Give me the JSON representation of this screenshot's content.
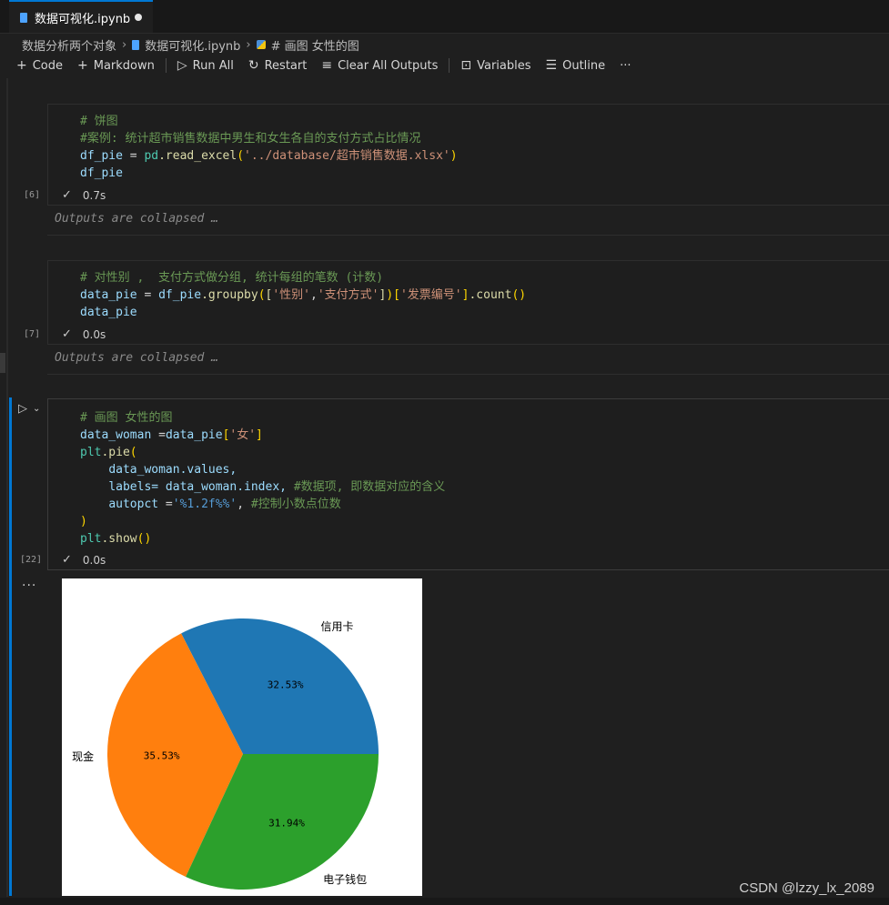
{
  "tab": {
    "title": "数据可视化.ipynb"
  },
  "breadcrumb": {
    "folder": "数据分析两个对象",
    "file": "数据可视化.ipynb",
    "symbol": "# 画图 女性的图"
  },
  "toolbar": {
    "code": "Code",
    "markdown": "Markdown",
    "run_all": "Run All",
    "restart": "Restart",
    "clear": "Clear All Outputs",
    "variables": "Variables",
    "outline": "Outline",
    "more": "···"
  },
  "cells": [
    {
      "count": "[6]",
      "time": "0.7s",
      "line1": "# 饼图",
      "line2": "#案例: 统计超市销售数据中男生和女生各自的支付方式占比情况",
      "line3_var": "df_pie",
      "line3_eq": " = ",
      "line3_mod": "pd",
      "line3_fn": ".read_excel",
      "line3_str": "'../database/超市销售数据.xlsx'",
      "line4": "df_pie",
      "collapsed": "Outputs are collapsed …"
    },
    {
      "count": "[7]",
      "time": "0.0s",
      "line1": "# 对性别 ,  支付方式做分组, 统计每组的笔数 (计数)",
      "line2_var": "data_pie",
      "line2_a": " = ",
      "line2_b": "df_pie",
      "line2_fn": ".groupby",
      "line2_s1": "'性别'",
      "line2_comma": ",",
      "line2_s2": "'支付方式'",
      "line2_s3": "'发票编号'",
      "line2_fn2": ".count",
      "line3": "data_pie",
      "collapsed": "Outputs are collapsed …"
    },
    {
      "count": "[22]",
      "time": "0.0s",
      "line1": "# 画图 女性的图",
      "line2_var": "data_woman",
      "line2_a": " =",
      "line2_b": "data_pie",
      "line2_s": "'女'",
      "line3_mod": "plt",
      "line3_fn": ".pie",
      "line4": "data_woman.values,",
      "line5_a": "labels",
      "line5_b": "= data_woman.index, ",
      "line5_c": "#数据项, 即数据对应的含义",
      "line6_a": "autopct",
      "line6_b": " =",
      "line6_s": "'%1.2f%%'",
      "line6_c": ", ",
      "line6_d": "#控制小数点位数",
      "line7": ")",
      "line8_mod": "plt",
      "line8_fn": ".show"
    }
  ],
  "output_menu": "···",
  "chart_data": {
    "type": "pie",
    "categories": [
      "信用卡",
      "现金",
      "电子钱包"
    ],
    "values": [
      32.53,
      35.53,
      31.94
    ],
    "value_labels": [
      "32.53%",
      "35.53%",
      "31.94%"
    ],
    "colors": [
      "#1f77b4",
      "#ff7f0e",
      "#2ca02c"
    ],
    "start_angle": 0,
    "direction": "counterclockwise"
  },
  "watermark": "CSDN @lzzy_lx_2089"
}
